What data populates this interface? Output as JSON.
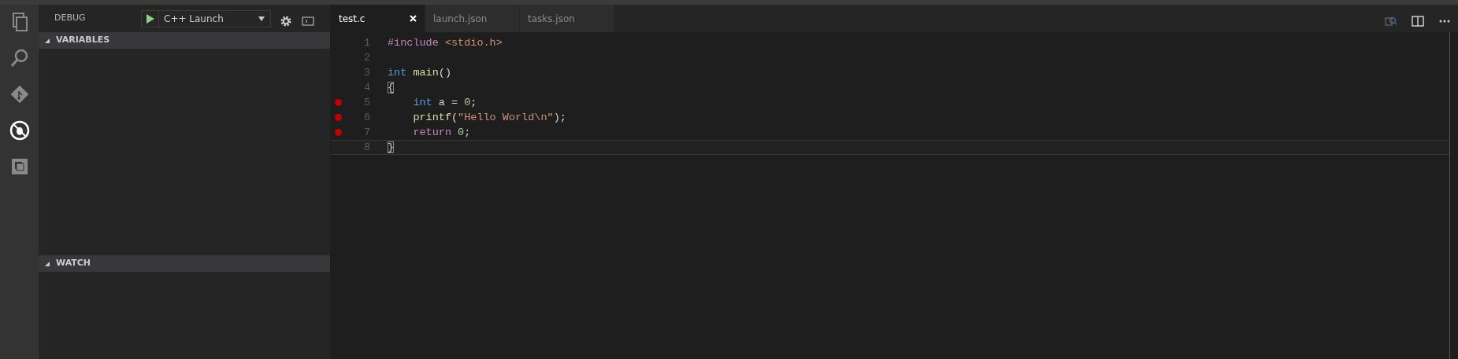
{
  "activity_bar": [
    {
      "kind": "files",
      "selected": false
    },
    {
      "kind": "search",
      "selected": false
    },
    {
      "kind": "git",
      "selected": false
    },
    {
      "kind": "debug",
      "selected": true
    },
    {
      "kind": "extensions",
      "selected": false
    }
  ],
  "sidebar": {
    "title": "DEBUG",
    "configuration": "C++ Launch",
    "sections": [
      {
        "title": "VARIABLES",
        "expanded": true
      },
      {
        "title": "WATCH",
        "expanded": true
      }
    ]
  },
  "tabs": [
    {
      "label": "test.c",
      "selected": true
    },
    {
      "label": "launch.json",
      "selected": false
    },
    {
      "label": "tasks.json",
      "selected": false
    }
  ],
  "editor": {
    "lines": [
      {
        "number": "1",
        "breakpoint": false,
        "current": false,
        "indent": false,
        "tokens": [
          {
            "kind": "keyword",
            "text": "#include"
          },
          {
            "kind": "string",
            "text": " <stdio.h>"
          }
        ]
      },
      {
        "number": "2",
        "breakpoint": false,
        "current": false
      },
      {
        "number": "3",
        "breakpoint": false,
        "current": false,
        "indent": false,
        "tokens": [
          {
            "kind": "type",
            "text": "int"
          },
          {
            "kind": "function",
            "text": " main"
          },
          {
            "kind": "plain",
            "text": "()"
          }
        ]
      },
      {
        "number": "4",
        "breakpoint": false,
        "current": false,
        "indent": false,
        "tokens": [
          {
            "kind": "bracket",
            "text": "{"
          }
        ]
      },
      {
        "number": "5",
        "breakpoint": true,
        "current": false,
        "indent": true,
        "tokens": [
          {
            "kind": "type",
            "text": "int"
          },
          {
            "kind": "plain",
            "text": " a ="
          },
          {
            "kind": "number",
            "text": " 0"
          },
          {
            "kind": "plain",
            "text": ";"
          }
        ]
      },
      {
        "number": "6",
        "breakpoint": true,
        "current": false,
        "indent": true,
        "tokens": [
          {
            "kind": "function",
            "text": "printf"
          },
          {
            "kind": "plain",
            "text": "("
          },
          {
            "kind": "string",
            "text": "\"Hello World\\n\""
          },
          {
            "kind": "plain",
            "text": ");"
          }
        ]
      },
      {
        "number": "7",
        "breakpoint": true,
        "current": false,
        "indent": true,
        "tokens": [
          {
            "kind": "keyword",
            "text": "return"
          },
          {
            "kind": "number",
            "text": " 0"
          },
          {
            "kind": "plain",
            "text": ";"
          }
        ]
      },
      {
        "number": "8",
        "breakpoint": false,
        "current": true,
        "indent": false,
        "tokens": [
          {
            "kind": "bracket",
            "text": "}"
          }
        ]
      }
    ]
  }
}
